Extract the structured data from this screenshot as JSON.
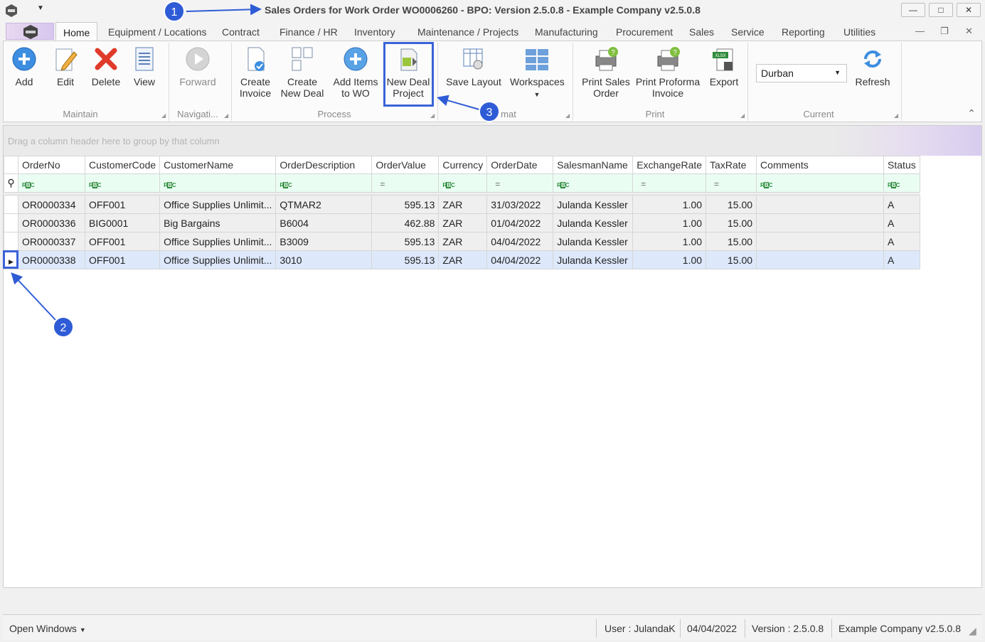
{
  "window": {
    "title": "Sales Orders for Work Order WO0006260 - BPO: Version 2.5.0.8 - Example Company v2.5.0.8",
    "minimize": "—",
    "maximize": "□",
    "close": "✕"
  },
  "tabs": [
    "Home",
    "Equipment / Locations",
    "Contract",
    "Finance / HR",
    "Inventory",
    "Maintenance / Projects",
    "Manufacturing",
    "Procurement",
    "Sales",
    "Service",
    "Reporting",
    "Utilities"
  ],
  "ribbon": {
    "maintain": {
      "label": "Maintain",
      "add": "Add",
      "edit": "Edit",
      "delete": "Delete",
      "view": "View"
    },
    "navigation": {
      "label": "Navigati...",
      "forward": "Forward"
    },
    "process": {
      "label": "Process",
      "create_invoice": [
        "Create",
        "Invoice"
      ],
      "create_new_deal": [
        "Create",
        "New Deal"
      ],
      "add_items_to_wo": [
        "Add Items",
        "to WO"
      ],
      "new_deal_project": [
        "New Deal",
        "Project"
      ]
    },
    "format": {
      "label": "mat",
      "save_layout": "Save Layout",
      "workspaces": "Workspaces"
    },
    "print": {
      "label": "Print",
      "print_sales_order": [
        "Print Sales",
        "Order"
      ],
      "print_proforma_invoice": [
        "Print Proforma",
        "Invoice"
      ],
      "export": "Export"
    },
    "current": {
      "label": "Current",
      "site": "Durban",
      "refresh": "Refresh"
    }
  },
  "grid": {
    "group_panel_text": "Drag a column header here to group by that column",
    "columns": [
      "OrderNo",
      "CustomerCode",
      "CustomerName",
      "OrderDescription",
      "OrderValue",
      "Currency",
      "OrderDate",
      "SalesmanName",
      "ExchangeRate",
      "TaxRate",
      "Comments",
      "Status"
    ],
    "rows": [
      [
        "OR0000334",
        "OFF001",
        "Office Supplies Unlimit...",
        "QTMAR2",
        "595.13",
        "ZAR",
        "31/03/2022",
        "Julanda Kessler",
        "1.00",
        "15.00",
        "",
        "A"
      ],
      [
        "OR0000336",
        "BIG0001",
        "Big Bargains",
        "B6004",
        "462.88",
        "ZAR",
        "01/04/2022",
        "Julanda Kessler",
        "1.00",
        "15.00",
        "",
        "A"
      ],
      [
        "OR0000337",
        "OFF001",
        "Office Supplies Unlimit...",
        "B3009",
        "595.13",
        "ZAR",
        "04/04/2022",
        "Julanda Kessler",
        "1.00",
        "15.00",
        "",
        "A"
      ],
      [
        "OR0000338",
        "OFF001",
        "Office Supplies Unlimit...",
        "3010",
        "595.13",
        "ZAR",
        "04/04/2022",
        "Julanda Kessler",
        "1.00",
        "15.00",
        "",
        "A"
      ]
    ],
    "selected_row": 3
  },
  "statusbar": {
    "open_windows": "Open Windows",
    "user": "User : JulandaK",
    "date": "04/04/2022",
    "version": "Version : 2.5.0.8",
    "company": "Example Company v2.5.0.8"
  },
  "annotations": [
    "1",
    "2",
    "3"
  ],
  "colors": {
    "annotation": "#2f5cd6",
    "selected_row": "#dde8fb",
    "filter_row": "#eafdf3"
  }
}
